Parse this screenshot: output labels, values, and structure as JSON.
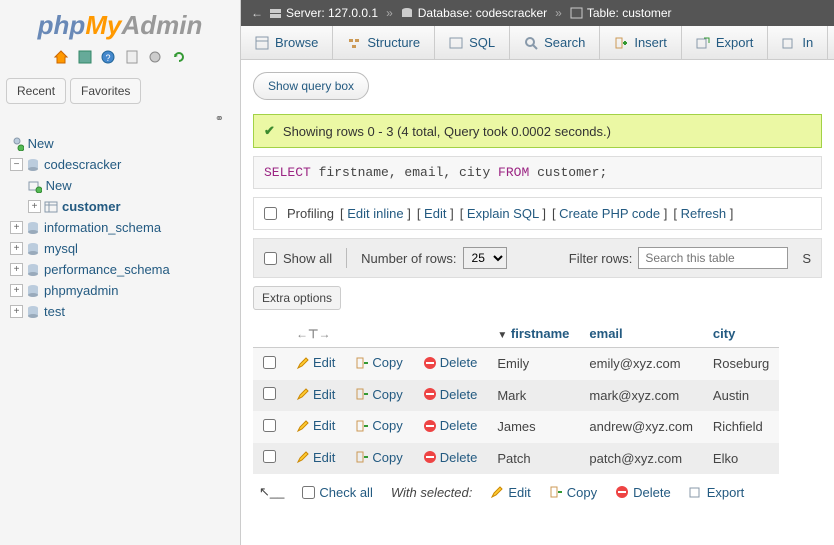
{
  "logo": {
    "php": "php",
    "my": "My",
    "admin": "Admin"
  },
  "side_tabs": {
    "recent": "Recent",
    "favorites": "Favorites"
  },
  "tree": {
    "new": "New",
    "db_active": "codescracker",
    "db_new": "New",
    "table_active": "customer",
    "others": [
      "information_schema",
      "mysql",
      "performance_schema",
      "phpmyadmin",
      "test"
    ]
  },
  "breadcrumb": {
    "server": "Server: 127.0.0.1",
    "database": "Database: codescracker",
    "table": "Table: customer"
  },
  "tabs": {
    "browse": "Browse",
    "structure": "Structure",
    "sql": "SQL",
    "search": "Search",
    "insert": "Insert",
    "export": "Export",
    "import": "In"
  },
  "query_box": "Show query box",
  "success_msg": "Showing rows 0 - 3 (4 total, Query took 0.0002 seconds.)",
  "sql": {
    "select": "SELECT",
    "fields": " firstname, email, city ",
    "from": "FROM",
    "table": " customer;"
  },
  "linkrow": {
    "profiling": "Profiling",
    "edit_inline": "Edit inline",
    "edit": "Edit",
    "explain": "Explain SQL",
    "create_php": "Create PHP code",
    "refresh": "Refresh"
  },
  "controlbar": {
    "showall": "Show all",
    "numrows": "Number of rows:",
    "numval": "25",
    "filter": "Filter rows:",
    "placeholder": "Search this table"
  },
  "extra_options": "Extra options",
  "columns": [
    "firstname",
    "email",
    "city"
  ],
  "row_actions": {
    "edit": "Edit",
    "copy": "Copy",
    "delete": "Delete"
  },
  "rows": [
    {
      "firstname": "Emily",
      "email": "emily@xyz.com",
      "city": "Roseburg"
    },
    {
      "firstname": "Mark",
      "email": "mark@xyz.com",
      "city": "Austin"
    },
    {
      "firstname": "James",
      "email": "andrew@xyz.com",
      "city": "Richfield"
    },
    {
      "firstname": "Patch",
      "email": "patch@xyz.com",
      "city": "Elko"
    }
  ],
  "bulk": {
    "checkall": "Check all",
    "withsel": "With selected:",
    "edit": "Edit",
    "copy": "Copy",
    "delete": "Delete",
    "export": "Export"
  }
}
